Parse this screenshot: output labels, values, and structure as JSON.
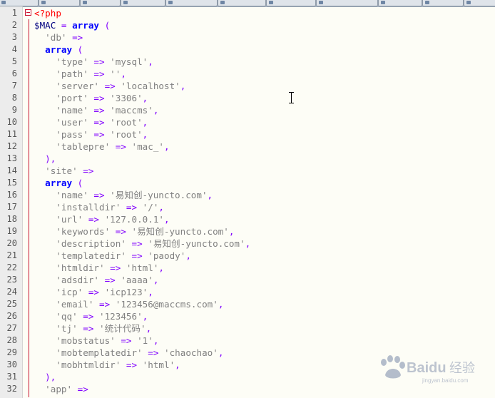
{
  "tabs": [
    "",
    "",
    "",
    "",
    "",
    "",
    "",
    "",
    "",
    "",
    ""
  ],
  "lines": [
    [
      [
        "php",
        "<?php"
      ]
    ],
    [
      [
        "var",
        "$MAC"
      ],
      [
        "op",
        " = "
      ],
      [
        "kw",
        "array"
      ],
      [
        "op",
        " ("
      ]
    ],
    [
      [
        "str",
        "  'db'"
      ],
      [
        "op",
        " =>"
      ]
    ],
    [
      [
        "kw",
        "  array"
      ],
      [
        "op",
        " ("
      ]
    ],
    [
      [
        "str",
        "    'type'"
      ],
      [
        "op",
        " => "
      ],
      [
        "str",
        "'mysql'"
      ],
      [
        "op",
        ","
      ]
    ],
    [
      [
        "str",
        "    'path'"
      ],
      [
        "op",
        " => "
      ],
      [
        "str",
        "''"
      ],
      [
        "op",
        ","
      ]
    ],
    [
      [
        "str",
        "    'server'"
      ],
      [
        "op",
        " => "
      ],
      [
        "str",
        "'localhost'"
      ],
      [
        "op",
        ","
      ]
    ],
    [
      [
        "str",
        "    'port'"
      ],
      [
        "op",
        " => "
      ],
      [
        "str",
        "'3306'"
      ],
      [
        "op",
        ","
      ]
    ],
    [
      [
        "str",
        "    'name'"
      ],
      [
        "op",
        " => "
      ],
      [
        "str",
        "'maccms'"
      ],
      [
        "op",
        ","
      ]
    ],
    [
      [
        "str",
        "    'user'"
      ],
      [
        "op",
        " => "
      ],
      [
        "str",
        "'root'"
      ],
      [
        "op",
        ","
      ]
    ],
    [
      [
        "str",
        "    'pass'"
      ],
      [
        "op",
        " => "
      ],
      [
        "str",
        "'root'"
      ],
      [
        "op",
        ","
      ]
    ],
    [
      [
        "str",
        "    'tablepre'"
      ],
      [
        "op",
        " => "
      ],
      [
        "str",
        "'mac_'"
      ],
      [
        "op",
        ","
      ]
    ],
    [
      [
        "op",
        "  ),"
      ]
    ],
    [
      [
        "str",
        "  'site'"
      ],
      [
        "op",
        " =>"
      ]
    ],
    [
      [
        "kw",
        "  array"
      ],
      [
        "op",
        " ("
      ]
    ],
    [
      [
        "str",
        "    'name'"
      ],
      [
        "op",
        " => "
      ],
      [
        "str",
        "'易知创-yuncto.com'"
      ],
      [
        "op",
        ","
      ]
    ],
    [
      [
        "str",
        "    'installdir'"
      ],
      [
        "op",
        " => "
      ],
      [
        "str",
        "'/'"
      ],
      [
        "op",
        ","
      ]
    ],
    [
      [
        "str",
        "    'url'"
      ],
      [
        "op",
        " => "
      ],
      [
        "str",
        "'127.0.0.1'"
      ],
      [
        "op",
        ","
      ]
    ],
    [
      [
        "str",
        "    'keywords'"
      ],
      [
        "op",
        " => "
      ],
      [
        "str",
        "'易知创-yuncto.com'"
      ],
      [
        "op",
        ","
      ]
    ],
    [
      [
        "str",
        "    'description'"
      ],
      [
        "op",
        " => "
      ],
      [
        "str",
        "'易知创-yuncto.com'"
      ],
      [
        "op",
        ","
      ]
    ],
    [
      [
        "str",
        "    'templatedir'"
      ],
      [
        "op",
        " => "
      ],
      [
        "str",
        "'paody'"
      ],
      [
        "op",
        ","
      ]
    ],
    [
      [
        "str",
        "    'htmldir'"
      ],
      [
        "op",
        " => "
      ],
      [
        "str",
        "'html'"
      ],
      [
        "op",
        ","
      ]
    ],
    [
      [
        "str",
        "    'adsdir'"
      ],
      [
        "op",
        " => "
      ],
      [
        "str",
        "'aaaa'"
      ],
      [
        "op",
        ","
      ]
    ],
    [
      [
        "str",
        "    'icp'"
      ],
      [
        "op",
        " => "
      ],
      [
        "str",
        "'icp123'"
      ],
      [
        "op",
        ","
      ]
    ],
    [
      [
        "str",
        "    'email'"
      ],
      [
        "op",
        " => "
      ],
      [
        "str",
        "'123456@maccms.com'"
      ],
      [
        "op",
        ","
      ]
    ],
    [
      [
        "str",
        "    'qq'"
      ],
      [
        "op",
        " => "
      ],
      [
        "str",
        "'123456'"
      ],
      [
        "op",
        ","
      ]
    ],
    [
      [
        "str",
        "    'tj'"
      ],
      [
        "op",
        " => "
      ],
      [
        "str",
        "'统计代码'"
      ],
      [
        "op",
        ","
      ]
    ],
    [
      [
        "str",
        "    'mobstatus'"
      ],
      [
        "op",
        " => "
      ],
      [
        "str",
        "'1'"
      ],
      [
        "op",
        ","
      ]
    ],
    [
      [
        "str",
        "    'mobtemplatedir'"
      ],
      [
        "op",
        " => "
      ],
      [
        "str",
        "'chaochao'"
      ],
      [
        "op",
        ","
      ]
    ],
    [
      [
        "str",
        "    'mobhtmldir'"
      ],
      [
        "op",
        " => "
      ],
      [
        "str",
        "'html'"
      ],
      [
        "op",
        ","
      ]
    ],
    [
      [
        "op",
        "  ),"
      ]
    ],
    [
      [
        "str",
        "  'app'"
      ],
      [
        "op",
        " =>"
      ]
    ]
  ],
  "watermark": {
    "brand": "Baidu",
    "cn": "经验",
    "url": "jingyan.baidu.com"
  }
}
